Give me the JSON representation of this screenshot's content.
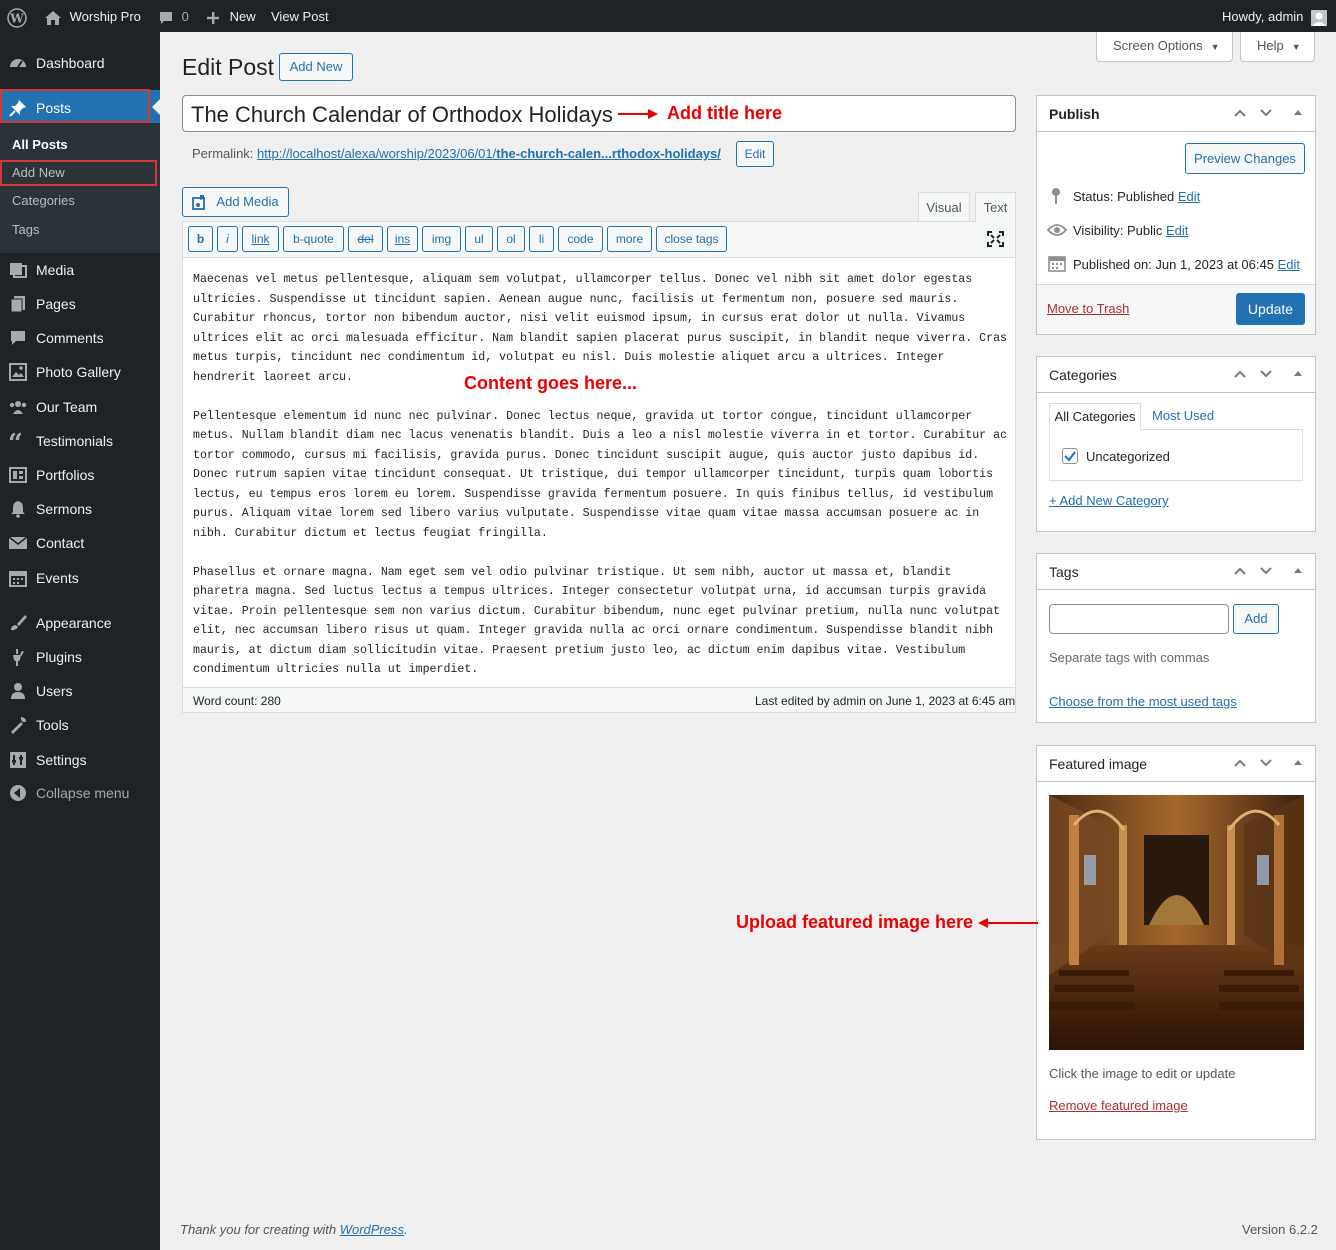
{
  "admin_bar": {
    "site_name": "Worship Pro",
    "comments_count": "0",
    "new_label": "New",
    "view_post": "View Post",
    "howdy": "Howdy, admin"
  },
  "sidebar": {
    "items": [
      {
        "label": "Dashboard",
        "icon": "dashboard-icon"
      },
      {
        "label": "Posts",
        "icon": "pin-icon"
      },
      {
        "label": "Media",
        "icon": "media-icon"
      },
      {
        "label": "Pages",
        "icon": "pages-icon"
      },
      {
        "label": "Comments",
        "icon": "comments-icon"
      },
      {
        "label": "Photo Gallery",
        "icon": "gallery-icon"
      },
      {
        "label": "Our Team",
        "icon": "team-icon"
      },
      {
        "label": "Testimonials",
        "icon": "quote-icon"
      },
      {
        "label": "Portfolios",
        "icon": "portfolio-icon"
      },
      {
        "label": "Sermons",
        "icon": "bell-icon"
      },
      {
        "label": "Contact",
        "icon": "mail-icon"
      },
      {
        "label": "Events",
        "icon": "calendar-icon"
      },
      {
        "label": "Appearance",
        "icon": "brush-icon"
      },
      {
        "label": "Plugins",
        "icon": "plugin-icon"
      },
      {
        "label": "Users",
        "icon": "user-icon"
      },
      {
        "label": "Tools",
        "icon": "wrench-icon"
      },
      {
        "label": "Settings",
        "icon": "settings-icon"
      }
    ],
    "posts_submenu": [
      "All Posts",
      "Add New",
      "Categories",
      "Tags"
    ],
    "collapse": "Collapse menu"
  },
  "header": {
    "screen_options": "Screen Options",
    "help": "Help",
    "page_title": "Edit Post",
    "add_new": "Add New"
  },
  "editor": {
    "title_value": "The Church Calendar of Orthodox Holidays",
    "permalink_label": "Permalink:",
    "permalink_prefix": "http://localhost/alexa/worship/2023/06/01/",
    "permalink_slug": "the-church-calen...rthodox-holidays/",
    "permalink_edit": "Edit",
    "add_media": "Add Media",
    "tab_visual": "Visual",
    "tab_text": "Text",
    "quicktags": [
      "b",
      "i",
      "link",
      "b-quote",
      "del",
      "ins",
      "img",
      "ul",
      "ol",
      "li",
      "code",
      "more",
      "close tags"
    ],
    "paragraphs": [
      "Maecenas vel metus pellentesque, aliquam sem volutpat, ullamcorper tellus. Donec vel nibh sit amet dolor egestas ultricies. Suspendisse ut tincidunt sapien. Aenean augue nunc, facilisis ut fermentum non, posuere sed mauris. Curabitur rhoncus, tortor non bibendum auctor, nisi velit euismod ipsum, in cursus erat dolor ut nulla. Vivamus ultrices elit ac orci malesuada efficitur. Nam blandit sapien placerat purus suscipit, in blandit neque viverra. Cras metus turpis, tincidunt nec condimentum id, volutpat eu nisl. Duis molestie aliquet arcu a ultrices. Integer hendrerit laoreet arcu.",
      "Pellentesque elementum id nunc nec pulvinar. Donec lectus neque, gravida ut tortor congue, tincidunt ullamcorper metus. Nullam blandit diam nec lacus venenatis blandit. Duis a leo a nisl molestie viverra in et tortor. Curabitur ac tortor commodo, cursus mi facilisis, gravida purus. Donec tincidunt suscipit augue, quis auctor justo dapibus id. Donec rutrum sapien vitae tincidunt consequat. Ut tristique, dui tempor ullamcorper tincidunt, turpis quam lobortis lectus, eu tempus eros lorem eu lorem. Suspendisse gravida fermentum posuere. In quis finibus tellus, id vestibulum purus. Aliquam vitae lorem sed libero varius vulputate. Suspendisse vitae quam vitae massa accumsan posuere ac in nibh. Curabitur dictum et lectus feugiat fringilla.",
      "Phasellus et ornare magna. Nam eget sem vel odio pulvinar tristique. Ut sem nibh, auctor ut massa et, blandit pharetra magna. Sed luctus lectus a tempus ultrices. Integer consectetur volutpat urna, id accumsan turpis gravida vitae. Proin pellentesque sem non varius dictum. Curabitur bibendum, nunc eget pulvinar pretium, nulla nunc volutpat elit, nec accumsan libero risus ut quam. Integer gravida nulla ac orci ornare condimentum. Suspendisse blandit nibh mauris, at dictum diam sollicitudin vitae. Praesent pretium justo leo, ac dictum enim dapibus vitae. Vestibulum condimentum ultricies nulla ut imperdiet."
    ],
    "word_count": "Word count: 280",
    "last_edited": "Last edited by admin on June 1, 2023 at 6:45 am"
  },
  "annotations": {
    "title": "Add title here",
    "content": "Content goes here...",
    "featured": "Upload featured image here"
  },
  "publish": {
    "title": "Publish",
    "preview": "Preview Changes",
    "status_label": "Status: ",
    "status_value": "Published",
    "visibility_label": "Visibility: ",
    "visibility_value": "Public",
    "published_label": "Published on: ",
    "published_value": "Jun 1, 2023 at 06:45",
    "edit": "Edit",
    "trash": "Move to Trash",
    "update": "Update"
  },
  "categories": {
    "title": "Categories",
    "tab_all": "All Categories",
    "tab_most_used": "Most Used",
    "items": [
      {
        "label": "Uncategorized",
        "checked": true
      }
    ],
    "add_new": "+ Add New Category"
  },
  "tags": {
    "title": "Tags",
    "input_value": "",
    "add": "Add",
    "hint": "Separate tags with commas",
    "choose": "Choose from the most used tags"
  },
  "featured_image": {
    "title": "Featured image",
    "caption": "Click the image to edit or update",
    "remove": "Remove featured image"
  },
  "footer": {
    "thanks_prefix": "Thank you for creating with ",
    "wordpress": "WordPress",
    "thanks_suffix": ".",
    "version": "Version 6.2.2"
  },
  "colors": {
    "admin_dark": "#1d2327",
    "accent": "#2271b1",
    "annotation_red": "#e00000"
  }
}
